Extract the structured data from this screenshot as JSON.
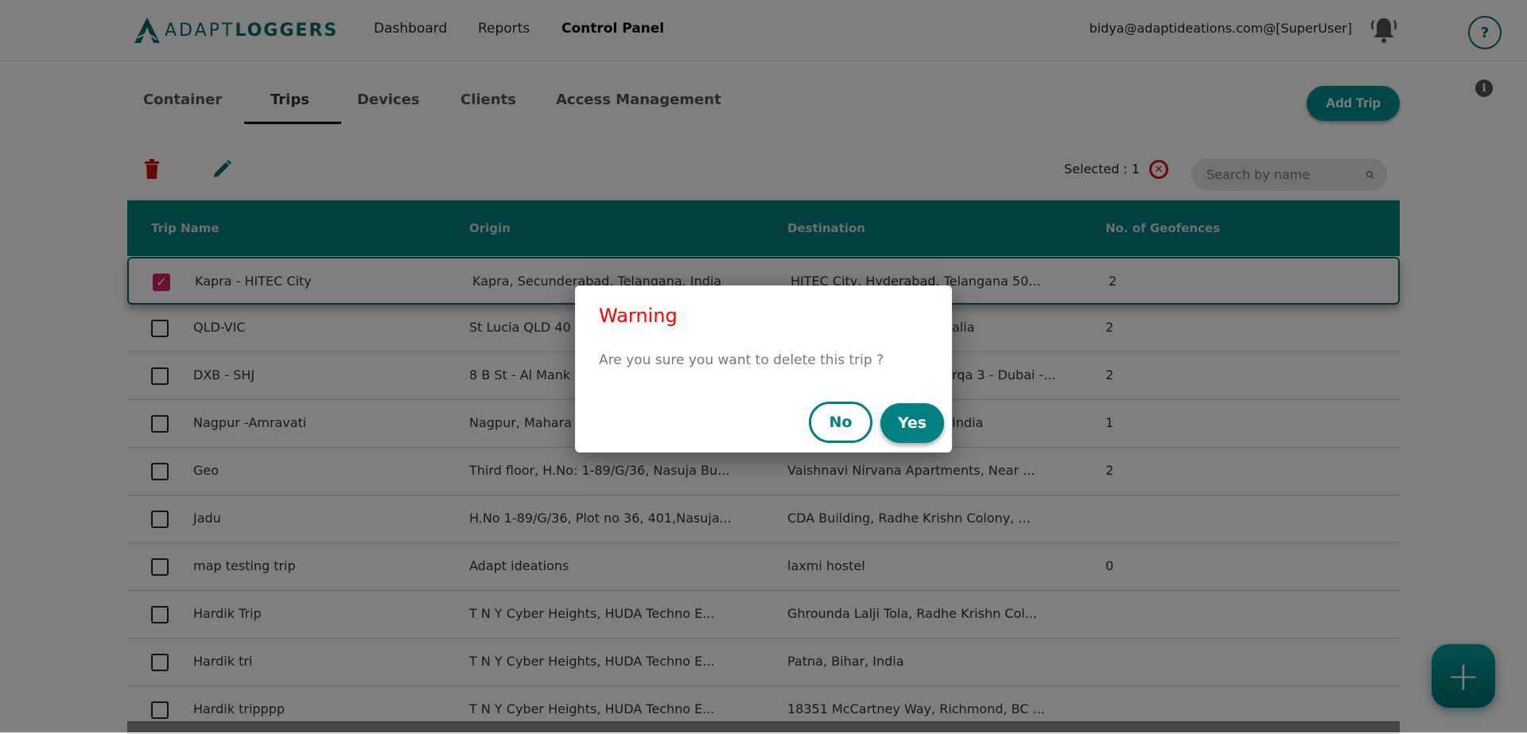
{
  "header": {
    "logo_light": "ADAPT",
    "logo_bold": "LOGGERS",
    "nav": [
      "Dashboard",
      "Reports",
      "Control Panel"
    ],
    "active_nav": "Control Panel",
    "user": "bidya@adaptideations.com@[SuperUser]",
    "help_label": "?"
  },
  "tabs": [
    "Container",
    "Trips",
    "Devices",
    "Clients",
    "Access Management"
  ],
  "active_tab": "Trips",
  "add_trip_label": "Add Trip",
  "info_label": "i",
  "toolbar": {
    "selected_label": "Selected : 1",
    "search_placeholder": "Search by name"
  },
  "table": {
    "columns": [
      "Trip Name",
      "Origin",
      "Destination",
      "No. of Geofences"
    ],
    "rows": [
      {
        "name": "Kapra - HITEC City",
        "origin": "Kapra, Secunderabad, Telangana, India",
        "destination": "HITEC City, Hyderabad, Telangana 50...",
        "geofences": "2",
        "checked": true
      },
      {
        "name": "QLD-VIC",
        "origin": "St Lucia QLD 40",
        "destination": "alia",
        "geofences": "2",
        "checked": false
      },
      {
        "name": "DXB - SHJ",
        "origin": "8 B St - Al Mank",
        "destination": "rqa 3 - Dubai -...",
        "geofences": "2",
        "checked": false
      },
      {
        "name": "Nagpur -Amravati",
        "origin": "Nagpur, Mahara",
        "destination": "India",
        "geofences": "1",
        "checked": false
      },
      {
        "name": "Geo",
        "origin": "Third floor, H.No: 1-89/G/36, Nasuja Bu...",
        "destination": "Vaishnavi Nirvana Apartments, Near ...",
        "geofences": "2",
        "checked": false
      },
      {
        "name": "Jadu",
        "origin": "H.No 1-89/G/36, Plot no 36, 401,Nasuja...",
        "destination": "CDA Building, Radhe Krishn Colony, ...",
        "geofences": "",
        "checked": false
      },
      {
        "name": "map testing trip",
        "origin": "Adapt ideations",
        "destination": "laxmi hostel",
        "geofences": "0",
        "checked": false
      },
      {
        "name": "Hardik Trip",
        "origin": "T N Y Cyber Heights, HUDA Techno E...",
        "destination": "Ghrounda Lalji Tola, Radhe Krishn Col...",
        "geofences": "",
        "checked": false
      },
      {
        "name": "Hardik tri",
        "origin": "T N Y Cyber Heights, HUDA Techno E...",
        "destination": "Patna, Bihar, India",
        "geofences": "",
        "checked": false
      },
      {
        "name": "Hardik tripppp",
        "origin": "T N Y Cyber Heights, HUDA Techno E...",
        "destination": "18351 McCartney Way, Richmond, BC ...",
        "geofences": "",
        "checked": false
      }
    ]
  },
  "fab_label": "+",
  "dialog": {
    "title": "Warning",
    "message": "Are you sure you want to delete this trip ?",
    "no_label": "No",
    "yes_label": "Yes"
  },
  "colors": {
    "accent": "#008080",
    "warning": "#ff0000",
    "delete": "#d01010",
    "checkbox": "#d4246a"
  },
  "icons": [
    "logo-icon",
    "bell-icon",
    "help-icon",
    "info-icon",
    "trash-icon",
    "pencil-icon",
    "clear-selection-icon",
    "search-icon",
    "plus-icon"
  ]
}
